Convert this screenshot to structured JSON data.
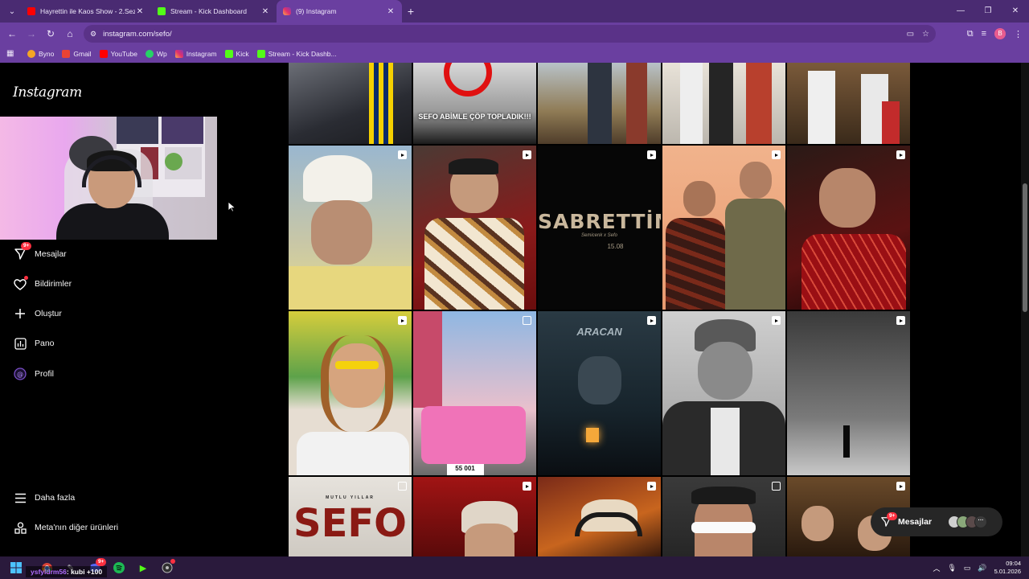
{
  "browser": {
    "tabs": [
      {
        "title": "Hayrettin ile Kaos Show - 2.Sez",
        "favicon_color": "#ff0000",
        "active": false
      },
      {
        "title": "Stream - Kick Dashboard",
        "favicon_color": "#53fc18",
        "active": false
      },
      {
        "title": "(9) Instagram",
        "favicon_color": "#e1306c",
        "active": true
      }
    ],
    "url": "instagram.com/sefo/",
    "bookmarks": [
      {
        "label": "Byno",
        "color": "#f5a623"
      },
      {
        "label": "Gmail",
        "color": "#ea4335"
      },
      {
        "label": "YouTube",
        "color": "#ff0000"
      },
      {
        "label": "Wp",
        "color": "#25d366"
      },
      {
        "label": "Instagram",
        "color": "#e1306c"
      },
      {
        "label": "Kick",
        "color": "#53fc18"
      },
      {
        "label": "Stream - Kick Dashb...",
        "color": "#53fc18"
      }
    ],
    "profile_initial": "B"
  },
  "sidebar": {
    "logo": "Instagram",
    "messages_badge": "9+",
    "items": [
      {
        "label": "Mesajlar",
        "icon": "messenger-icon"
      },
      {
        "label": "Bildirimler",
        "icon": "heart-icon"
      },
      {
        "label": "Oluştur",
        "icon": "plus-icon"
      },
      {
        "label": "Pano",
        "icon": "dashboard-icon"
      },
      {
        "label": "Profil",
        "icon": "threads-icon"
      }
    ],
    "bottom_items": [
      {
        "label": "Daha fazla",
        "icon": "hamburger-icon"
      },
      {
        "label": "Meta'nın diğer ürünleri",
        "icon": "meta-products-icon"
      }
    ]
  },
  "grid": {
    "top_row_caption": "SEFO ABİMLE ÇÖP TOPLADIK!!!",
    "sabrettim_title": "SABRETTİM",
    "sabrettim_sub": "Semicenk x Sefo",
    "sabrettim_date": "15.08",
    "aracan_title": "ARACAN",
    "plate_text": "55 001",
    "sefo_title": "SEFO",
    "sefo_sub": "MUTLU YILLAR"
  },
  "messages_pill": {
    "label": "Mesajlar",
    "badge": "9+"
  },
  "taskbar": {
    "chat_user": "ysfyldrm56",
    "chat_text": ": kubi +100",
    "discord_badge": "9+",
    "time": "09:04",
    "date": "5.01.2026"
  }
}
